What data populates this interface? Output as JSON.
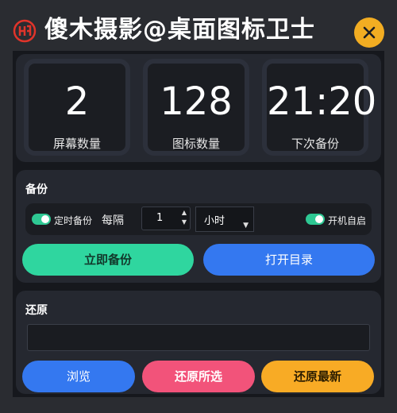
{
  "header": {
    "title": "傻木摄影@桌面图标卫士",
    "accent": "#f2ad22",
    "logo_color": "#e0342a"
  },
  "stats": [
    {
      "value": "2",
      "label": "屏幕数量"
    },
    {
      "value": "128",
      "label": "图标数量"
    },
    {
      "value": "21:20",
      "label": "下次备份"
    }
  ],
  "backup": {
    "title": "备份",
    "timer_toggle_label": "定时备份",
    "timer_toggle_on": true,
    "every_label": "每隔",
    "interval_value": "1",
    "unit_selected": "小时",
    "autostart_label": "开机自启",
    "autostart_on": true,
    "backup_now_label": "立即备份",
    "open_dir_label": "打开目录",
    "colors": {
      "toggle": "#2ec893",
      "backup_now": "#2fd69f",
      "open_dir": "#3478f0"
    }
  },
  "restore": {
    "title": "还原",
    "path_value": "",
    "browse_label": "浏览",
    "restore_selected_label": "还原所选",
    "restore_latest_label": "还原最新",
    "colors": {
      "browse": "#3478f0",
      "restore_selected": "#f2537a",
      "restore_latest": "#f8ab25"
    }
  }
}
